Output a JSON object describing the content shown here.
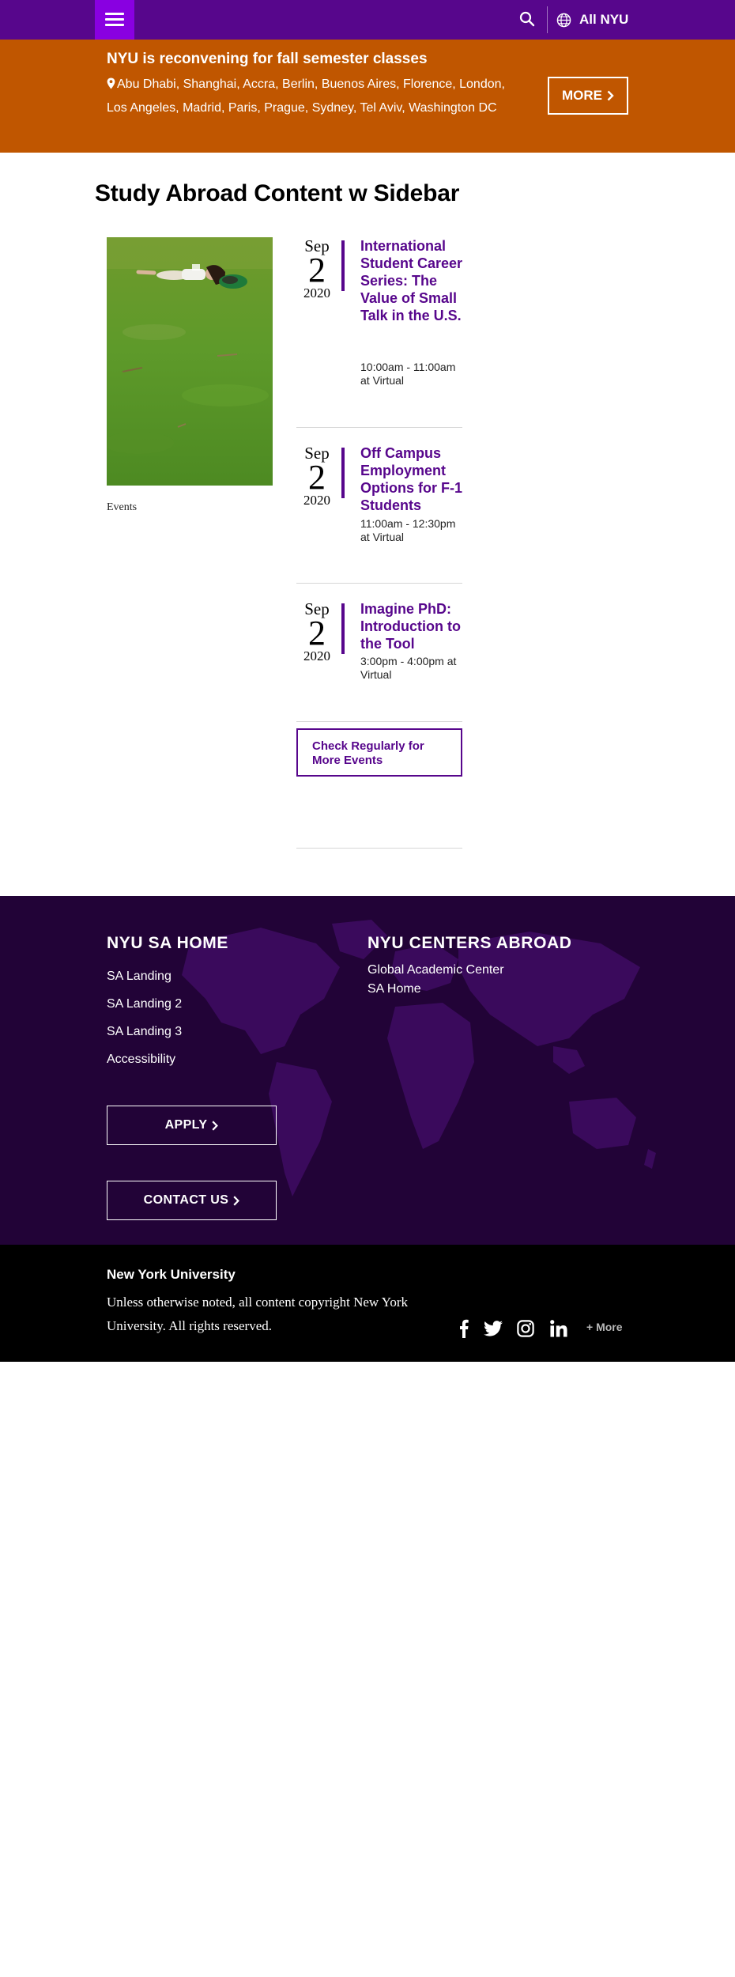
{
  "header": {
    "menu_icon": "hamburger-icon",
    "search_icon": "search-icon",
    "globe_icon": "globe-icon",
    "all_nyu_label": "All NYU",
    "bar_color": "#57068c",
    "menu_color": "#8900e1"
  },
  "alert": {
    "title": "NYU is reconvening for fall semester classes",
    "pin_icon": "map-pin-icon",
    "locations": "Abu Dhabi, Shanghai, Accra, Berlin, Buenos Aires, Florence, London, Los Angeles, Madrid, Paris, Prague, Sydney, Tel Aviv, Washington DC",
    "more_label": "MORE",
    "background": "#c05600"
  },
  "page": {
    "title": "Study Abroad Content w Sidebar"
  },
  "sidebar": {
    "image_caption": "Events"
  },
  "events": [
    {
      "month": "Sep",
      "day": "2",
      "year": "2020",
      "title": "International Student Career Series: The Value of Small Talk in the U.S.",
      "meta": "10:00am - 11:00am at Virtual"
    },
    {
      "month": "Sep",
      "day": "2",
      "year": "2020",
      "title": "Off Campus Employment Options for F-1 Students",
      "meta": "11:00am - 12:30pm at Virtual"
    },
    {
      "month": "Sep",
      "day": "2",
      "year": "2020",
      "title": "Imagine PhD: Introduction to the Tool",
      "meta": "3:00pm - 4:00pm at Virtual"
    }
  ],
  "check_more_label": "Check Regularly for More Events",
  "footer": {
    "background": "#220337",
    "col1_title": "NYU SA HOME",
    "col1_links": [
      "SA Landing",
      "SA Landing 2",
      "SA Landing 3",
      "Accessibility"
    ],
    "col2_title": "NYU CENTERS ABROAD",
    "col2_links": [
      "Global Academic Center",
      "SA Home"
    ],
    "apply_label": "APPLY",
    "contact_label": "CONTACT US"
  },
  "copyright": {
    "title": "New York University",
    "text": "Unless otherwise noted, all content copyright New York University. All rights reserved.",
    "social_icons": [
      "facebook-icon",
      "twitter-icon",
      "instagram-icon",
      "linkedin-icon"
    ],
    "more_label": "+ More"
  }
}
